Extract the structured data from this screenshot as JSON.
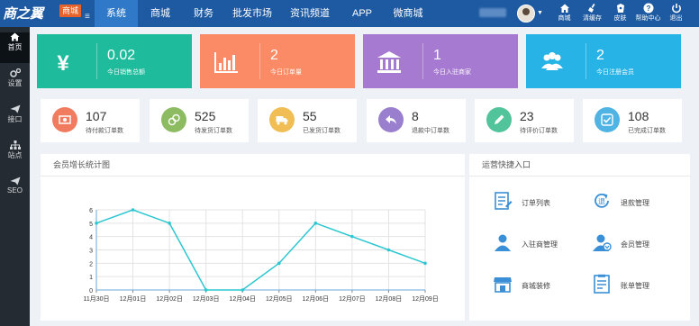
{
  "header": {
    "logo": "商之翼",
    "logo_badge": "商城",
    "nav": [
      {
        "label": "系统",
        "active": true
      },
      {
        "label": "商城"
      },
      {
        "label": "财务"
      },
      {
        "label": "批发市场"
      },
      {
        "label": "资讯频道"
      },
      {
        "label": "APP"
      },
      {
        "label": "微商城"
      }
    ],
    "tools": [
      {
        "label": "商城",
        "icon": "home-icon"
      },
      {
        "label": "清缓存",
        "icon": "broom-icon"
      },
      {
        "label": "皮肤",
        "icon": "palette-icon"
      },
      {
        "label": "帮助中心",
        "icon": "help-icon"
      },
      {
        "label": "退出",
        "icon": "power-icon"
      }
    ]
  },
  "sidebar": {
    "items": [
      {
        "label": "首页",
        "icon": "home-icon",
        "active": true
      },
      {
        "label": "设置",
        "icon": "gears-icon"
      },
      {
        "label": "接口",
        "icon": "paper-plane-icon"
      },
      {
        "label": "站点",
        "icon": "sitemap-icon"
      },
      {
        "label": "SEO",
        "icon": "send-icon"
      }
    ]
  },
  "stats": [
    {
      "value": "0.02",
      "label": "今日销售总额",
      "color": "#1ebc9c",
      "icon": "yen-icon"
    },
    {
      "value": "2",
      "label": "今日订单量",
      "color": "#fb8a66",
      "icon": "bar-chart-icon"
    },
    {
      "value": "1",
      "label": "今日入驻商家",
      "color": "#a77ad1",
      "icon": "bank-icon"
    },
    {
      "value": "2",
      "label": "今日注册会员",
      "color": "#28b3e6",
      "icon": "users-icon"
    }
  ],
  "orders": [
    {
      "value": "107",
      "label": "待付款订单数",
      "color": "#f07b5f",
      "icon": "money-icon"
    },
    {
      "value": "525",
      "label": "待发货订单数",
      "color": "#8dbb61",
      "icon": "coins-icon"
    },
    {
      "value": "55",
      "label": "已发货订单数",
      "color": "#f0be55",
      "icon": "truck-icon"
    },
    {
      "value": "8",
      "label": "退款中订单数",
      "color": "#9a7fcf",
      "icon": "reply-icon"
    },
    {
      "value": "23",
      "label": "待评价订单数",
      "color": "#52c49c",
      "icon": "pencil-icon"
    },
    {
      "value": "108",
      "label": "已完成订单数",
      "color": "#4fb3e3",
      "icon": "check-icon"
    }
  ],
  "growth_panel": {
    "title": "会员增长统计图"
  },
  "chart_data": {
    "type": "line",
    "categories": [
      "11月30日",
      "12月01日",
      "12月02日",
      "12月03日",
      "12月04日",
      "12月05日",
      "12月06日",
      "12月07日",
      "12月08日",
      "12月09日"
    ],
    "values": [
      5,
      6,
      5,
      0,
      0,
      2,
      5,
      4,
      3,
      2
    ],
    "ylim": [
      0,
      6
    ],
    "yticks": [
      "0",
      "1",
      "2",
      "3",
      "4",
      "5",
      "6"
    ],
    "grid": true,
    "color": "#2cc7d0"
  },
  "quick_panel": {
    "title": "运营快捷入口",
    "items": [
      {
        "label": "订单列表",
        "icon": "order-list-icon"
      },
      {
        "label": "退款管理",
        "icon": "refund-icon"
      },
      {
        "label": "入驻商管理",
        "icon": "merchant-icon"
      },
      {
        "label": "会员管理",
        "icon": "member-icon"
      },
      {
        "label": "商城装修",
        "icon": "shop-decor-icon"
      },
      {
        "label": "账单管理",
        "icon": "bill-icon"
      }
    ]
  }
}
